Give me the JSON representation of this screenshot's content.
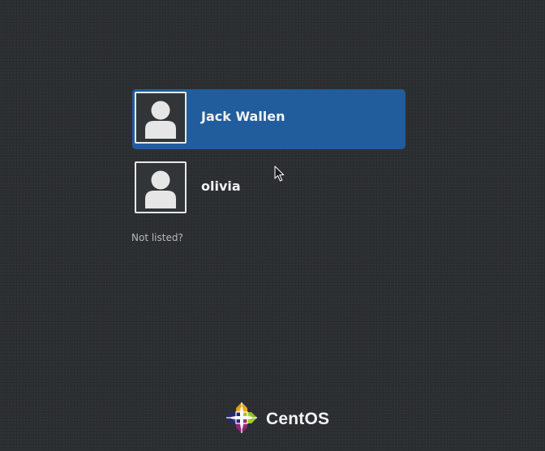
{
  "users": [
    {
      "name": "Jack Wallen",
      "selected": true,
      "icon": "user-avatar-icon"
    },
    {
      "name": "olivia",
      "selected": false,
      "icon": "user-avatar-icon"
    }
  ],
  "not_listed_label": "Not listed?",
  "brand": {
    "name": "CentOS",
    "icon": "centos-logo-icon"
  },
  "colors": {
    "background": "#2d3033",
    "selection": "#215d9c",
    "text": "#eeeeec",
    "muted_text": "#b8b9b6"
  },
  "pointer": "arrow-cursor-icon"
}
